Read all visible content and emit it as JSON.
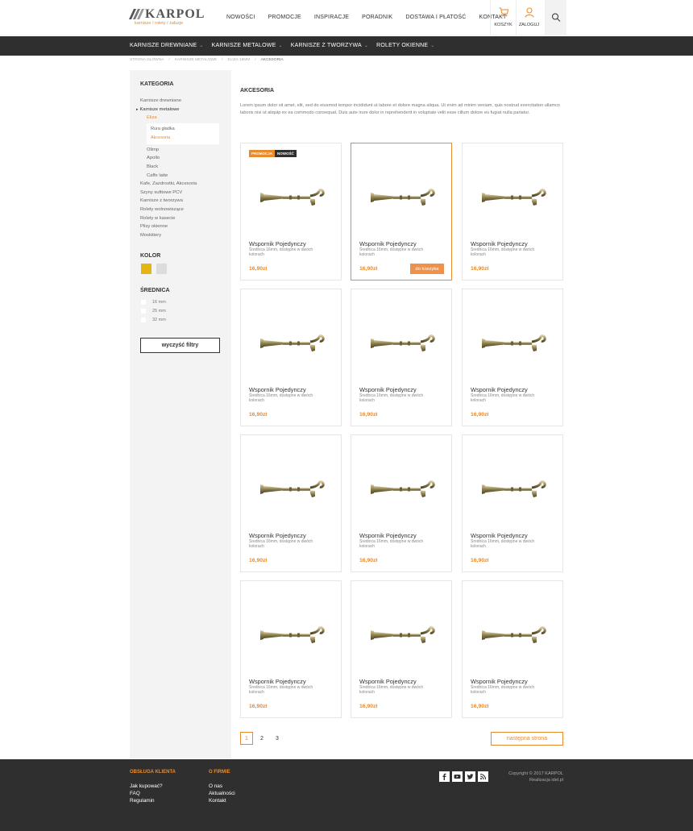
{
  "brand": {
    "name": "KARPOL",
    "tagline": "karnisze / rolety / żaluzje",
    "accent": "#e88a2e"
  },
  "topnav": [
    "NOWOŚCI",
    "PROMOCJE",
    "INSPIRACJE",
    "PORADNIK",
    "DOSTAWA I PŁATOŚĆ",
    "KONTAKT"
  ],
  "actions": {
    "cart": {
      "label": "KOSZYK",
      "icon": "cart-icon"
    },
    "login": {
      "label": "ZALOGUJ",
      "icon": "user-icon"
    },
    "search": {
      "icon": "search-icon"
    }
  },
  "categories": [
    "KARNISZE DREWNIANE",
    "KARNISZE METALOWE",
    "KARNISZE Z TWORZYWA",
    "ROLETY OKIENNE"
  ],
  "breadcrumb": [
    "STRONA GŁÓWNA",
    "KARNISZE METALOWE",
    "ELIZA 16MM",
    "AKCESORIA"
  ],
  "sidebar": {
    "category_title": "KATEGORIA",
    "links": {
      "drewniane": "Karnisze drewniane",
      "metalowe": "Karnisze metalowe",
      "eliza": "Eliza",
      "rura": "Rura gładka",
      "akcesoria": "Akcesoria",
      "olimp": "Olimp",
      "apollo": "Apollo",
      "black": "Black",
      "caffe": "Caffe latte",
      "kafe": "Kafe, Zazdrostki, Akcesoria",
      "szyny": "Szyny sufitowe PCV",
      "tworzywa": "Karnisze z tworzywa",
      "wolnowiszace": "Rolety wolnowiszące",
      "kasecie": "Rolety w kasecie",
      "plisy": "Plisy okienne",
      "moskitiery": "Moskitiery"
    },
    "color_title": "KOLOR",
    "colors": [
      "#e5b514",
      "#dcdcdc"
    ],
    "diameter_title": "ŚREDNICA",
    "diameters": [
      "16 mm",
      "25 mm",
      "32 mm"
    ],
    "clear_label": "wyczyść filtry"
  },
  "main": {
    "title": "AKCESORIA",
    "description": "Lorem ipsum dolor sit amet, elit, sed do eiusmod tempor incididunt ut labore et dolore magna aliqua. Ut enim ad minim veniam, quis nostrud exercitation ullamco laboris nisi ut aliquip ex ea commodo consequat. Duis aute irure dolor in reprehenderit in voluptate velit esse cillum dolore eu fugiat nulla pariatur."
  },
  "product": {
    "name": "Wspornik Pojedynczy",
    "desc": "Średnica 16mm, dostępne w dwóch kolorach",
    "price": "16,90zł",
    "badge_promo": "PROMOCJA",
    "badge_new": "NOWOŚĆ",
    "cart_label": "do koszyka"
  },
  "pagination": {
    "pages": [
      "1",
      "2",
      "3"
    ],
    "next_label": "następna strona"
  },
  "footer": {
    "col1_title": "OBSŁUGA KLIENTA",
    "col1_links": [
      "Jak kupować?",
      "FAQ",
      "Regulamin"
    ],
    "col2_title": "O FIRMIE",
    "col2_links": [
      "O nas",
      "Aktualności",
      "Kontakt"
    ],
    "social": [
      "facebook-icon",
      "youtube-icon",
      "twitter-icon",
      "rss-icon"
    ],
    "copyright": "Copyright © 2017 KARPOL",
    "realization": "Realizacja idel.pl"
  }
}
